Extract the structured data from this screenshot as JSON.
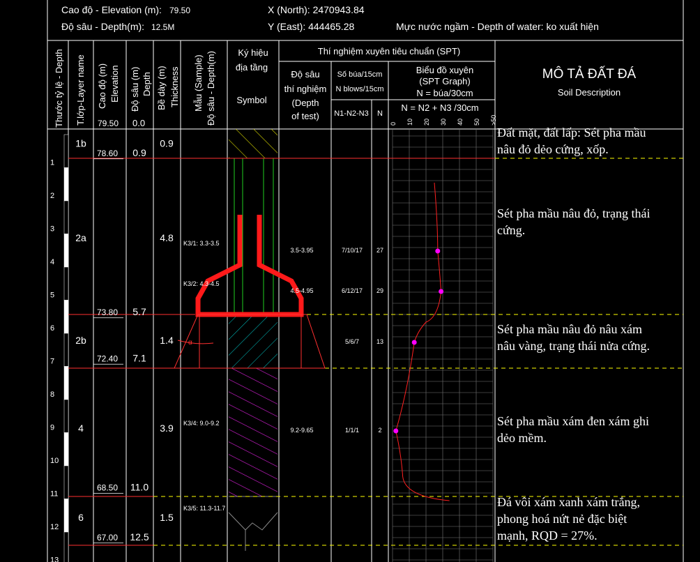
{
  "header": {
    "elevation_label": "Cao độ - Elevation (m):",
    "elevation_value": "79.50",
    "depth_label": "Độ sâu - Depth(m):",
    "depth_value": "12.5M",
    "north_label": "X (North): 2470943.84",
    "east_label": "Y (East): 444465.28",
    "water_label": "Mực nước ngầm - Depth of water: ko xuất hiện"
  },
  "columns": {
    "scale_depth": "Thước tỷ lệ - Depth",
    "layer_name": "T.lớp-Layer name",
    "elevation_vi": "Cao độ (m)",
    "elevation_en": "Elevation",
    "depth_vi": "Độ sâu (m)",
    "depth_en": "Depth",
    "thickness_vi": "Bề dày (m)",
    "thickness_en": "Thickness",
    "sample_vi": "Mẫu (Sample)",
    "sample_en": "Độ sâu - Depth(m)",
    "symbol_vi_1": "Ký hiệu",
    "symbol_vi_2": "địa tầng",
    "symbol_en": "Symbol",
    "spt_title": "Thí nghiệm xuyên tiêu chuẩn (SPT)",
    "test_depth_1": "Độ sâu",
    "test_depth_2": "thí nghiệm",
    "test_depth_3": "(Depth",
    "test_depth_4": "of test)",
    "blows_1": "Số búa/15cm",
    "blows_2": "N blows/15cm",
    "n123": "N1-N2-N3",
    "n": "N",
    "graph_1": "Biểu đồ xuyên",
    "graph_2": "(SPT Graph)",
    "graph_3": "N = búa/30cm",
    "formula": "N = N2 + N3 /30cm",
    "desc_vi": "MÔ TẢ ĐẤT ĐÁ",
    "desc_en": "Soil Description",
    "top_elevation": "79.50",
    "top_depth": "0.0"
  },
  "graph_ticks": [
    "0",
    "10",
    "20",
    "30",
    "40",
    "50",
    ">50"
  ],
  "scale_ticks": [
    "1",
    "2",
    "3",
    "4",
    "5",
    "6",
    "7",
    "8",
    "9",
    "10",
    "11",
    "12",
    "13"
  ],
  "layers": [
    {
      "name": "1b",
      "elevation": "78.60",
      "depth": "0.9",
      "thickness": "0.9",
      "description": [
        "Đất mặt, đất lấp: Sét pha mầu",
        "nâu đỏ dẻo cứng, xốp."
      ]
    },
    {
      "name": "2a",
      "elevation": "73.80",
      "depth": "5.7",
      "thickness": "4.8",
      "description": [
        "Sét pha mầu nâu đỏ, trạng thái",
        "cứng."
      ]
    },
    {
      "name": "2b",
      "elevation": "72.40",
      "depth": "7.1",
      "thickness": "1.4",
      "description": [
        "Sét pha mầu nâu đỏ nâu xám",
        "nâu vàng, trạng thái nửa cứng."
      ]
    },
    {
      "name": "4",
      "elevation": "68.50",
      "depth": "11.0",
      "thickness": "3.9",
      "description": [
        "Sét pha mầu xám đen xám ghi",
        "dẻo mềm."
      ]
    },
    {
      "name": "6",
      "elevation": "67.00",
      "depth": "12.5",
      "thickness": "1.5",
      "description": [
        "Đá vôi xám xanh xám trắng,",
        "phong hoá nứt nẻ đặc biệt",
        "mạnh, RQD = 27%."
      ]
    }
  ],
  "samples": [
    {
      "label": "K3/1: 3.3-3.5"
    },
    {
      "label": "K3/2: 4.3-4.5"
    },
    {
      "label": "K3/4: 9.0-9.2"
    },
    {
      "label": "K3/5: 11.3-11.7"
    }
  ],
  "spt": [
    {
      "depth": "3.5-3.95",
      "blows": "7/10/17",
      "n": "27"
    },
    {
      "depth": "4.5-4.95",
      "blows": "6/12/17",
      "n": "29"
    },
    {
      "depth": "",
      "blows": "5/6/7",
      "n": "13"
    },
    {
      "depth": "9.2-9.65",
      "blows": "1/1/1",
      "n": "2"
    }
  ],
  "colors": {
    "line": "#ffffff",
    "layer_boundary": "#ffff00",
    "foundation": "#ff1a1a",
    "graph": "#ff2020",
    "point": "#ff00ff"
  }
}
